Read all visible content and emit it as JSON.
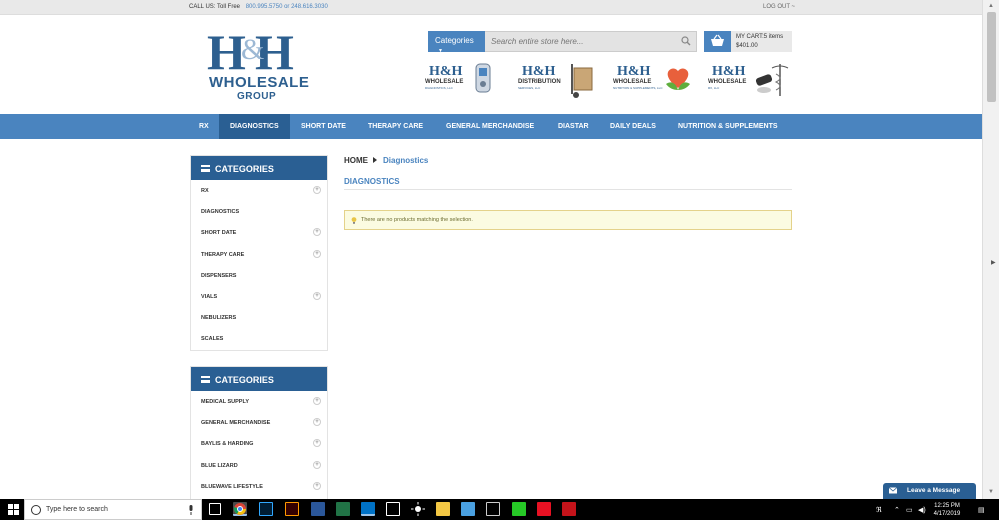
{
  "topbar": {
    "call_label": "CALL US: Toll Free",
    "phones": "800.995.5750 or 248.616.3030",
    "logout": "LOG OUT ~"
  },
  "logo": {
    "wholesale": "WHOLESALE",
    "group": "GROUP"
  },
  "search": {
    "categories_label": "Categories",
    "placeholder": "Search entire store here..."
  },
  "cart": {
    "items_label": "MY CART:5 items",
    "total": "$401.00"
  },
  "brands": [
    {
      "mono": "H&H",
      "name": "WHOLESALE",
      "sub": "DIAGNOSTICS, LLC"
    },
    {
      "mono": "H&H",
      "name": "DISTRIBUTION",
      "sub": "SERVICES, LLC"
    },
    {
      "mono": "H&H",
      "name": "WHOLESALE",
      "sub": "NUTRITION & SUPPLEMENTS, LLC"
    },
    {
      "mono": "H&H",
      "name": "WHOLESALE",
      "sub": "RX, LLC"
    }
  ],
  "nav": {
    "items": [
      {
        "label": "RX"
      },
      {
        "label": "DIAGNOSTICS"
      },
      {
        "label": "SHORT DATE"
      },
      {
        "label": "THERAPY CARE"
      },
      {
        "label": "GENERAL MERCHANDISE"
      },
      {
        "label": "DIASTAR"
      },
      {
        "label": "DAILY DEALS"
      },
      {
        "label": "NUTRITION & SUPPLEMENTS"
      }
    ]
  },
  "sidebar1": {
    "title": "CATEGORIES",
    "items": [
      {
        "label": "RX"
      },
      {
        "label": "DIAGNOSTICS"
      },
      {
        "label": "SHORT DATE"
      },
      {
        "label": "THERAPY CARE"
      },
      {
        "label": "DISPENSERS"
      },
      {
        "label": "VIALS"
      },
      {
        "label": "NEBULIZERS"
      },
      {
        "label": "SCALES"
      }
    ]
  },
  "sidebar2": {
    "title": "CATEGORIES",
    "items": [
      {
        "label": "MEDICAL SUPPLY"
      },
      {
        "label": "GENERAL MERCHANDISE"
      },
      {
        "label": "BAYLIS & HARDING"
      },
      {
        "label": "BLUE LIZARD"
      },
      {
        "label": "BLUEWAVE LIFESTYLE"
      }
    ]
  },
  "breadcrumb": {
    "home": "HOME",
    "current": "Diagnostics"
  },
  "page": {
    "title": "DIAGNOSTICS",
    "notice": "There are no products matching the selection."
  },
  "chat": {
    "label": "Leave a Message"
  },
  "taskbar": {
    "search_placeholder": "Type here to search",
    "time": "12:25 PM",
    "date": "4/17/2019"
  },
  "colors": {
    "accent": "#4a84bf",
    "dark_accent": "#2a5f93"
  }
}
